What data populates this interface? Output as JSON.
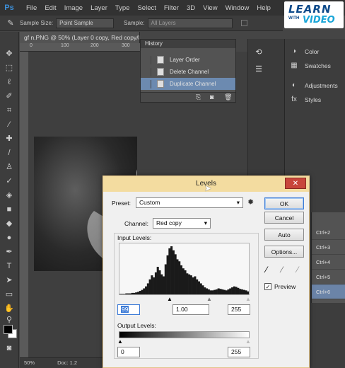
{
  "app": {
    "logo": "Ps"
  },
  "menu": [
    "File",
    "Edit",
    "Image",
    "Layer",
    "Type",
    "Select",
    "Filter",
    "3D",
    "View",
    "Window",
    "Help"
  ],
  "branding": {
    "line1": "LEARN",
    "line2": "WITH",
    "line3": "VIDEO"
  },
  "options_bar": {
    "sample_size_label": "Sample Size:",
    "sample_size_value": "Point Sample",
    "sample_label": "Sample:",
    "sample_value": "All Layers"
  },
  "document": {
    "tab_title": "gf n.PNG @ 50% (Layer 0 copy, Red copy/8)",
    "ruler_ticks": [
      "0",
      "100",
      "200",
      "300"
    ],
    "zoom": "50%",
    "doc_info": "Doc: 1.2"
  },
  "history": {
    "title": "History",
    "items": [
      "Layer Order",
      "Delete Channel",
      "Duplicate Channel"
    ]
  },
  "dock": {
    "items": [
      "Color",
      "Swatches",
      "Adjustments",
      "Styles"
    ]
  },
  "shortcuts": [
    "Ctrl+2",
    "Ctrl+3",
    "Ctrl+4",
    "Ctrl+5",
    "Ctrl+6"
  ],
  "levels": {
    "title": "Levels",
    "preset_label": "Preset:",
    "preset_value": "Custom",
    "channel_label": "Channel:",
    "channel_value": "Red copy",
    "input_levels_label": "Input Levels:",
    "input_black": "99",
    "input_gamma": "1.00",
    "input_white": "255",
    "output_levels_label": "Output Levels:",
    "output_black": "0",
    "output_white": "255",
    "buttons": {
      "ok": "OK",
      "cancel": "Cancel",
      "auto": "Auto",
      "options": "Options..."
    },
    "preview_label": "Preview",
    "preview_checked": true
  },
  "histogram_profile": [
    1,
    1,
    1,
    2,
    2,
    2,
    3,
    3,
    4,
    5,
    7,
    9,
    12,
    16,
    22,
    30,
    38,
    34,
    44,
    55,
    48,
    40,
    36,
    60,
    78,
    92,
    96,
    88,
    80,
    70,
    66,
    58,
    52,
    48,
    42,
    40,
    38,
    34,
    36,
    30,
    26,
    22,
    18,
    14,
    12,
    10,
    8,
    8,
    9,
    10,
    12,
    11,
    10,
    9,
    8,
    10,
    12,
    14,
    16,
    15,
    13,
    11,
    10,
    9,
    8,
    6
  ]
}
